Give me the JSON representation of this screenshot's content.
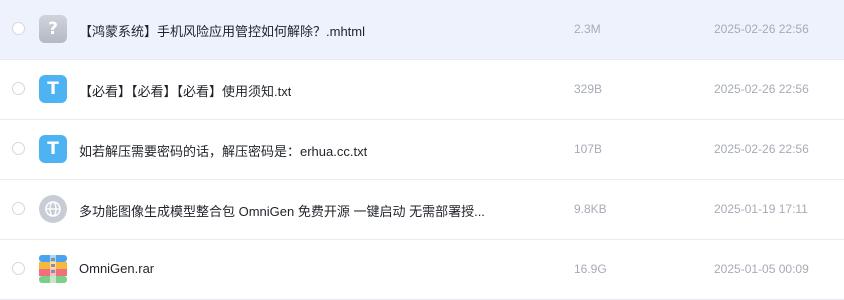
{
  "files": [
    {
      "name": "【鸿蒙系统】手机风险应用管控如何解除？.mhtml",
      "size": "2.3M",
      "date": "2025-02-26 22:56",
      "icon": "unknown-file-icon",
      "icon_glyph": "?"
    },
    {
      "name": "【必看】【必看】【必看】使用须知.txt",
      "size": "329B",
      "date": "2025-02-26 22:56",
      "icon": "text-file-icon",
      "icon_glyph": "T"
    },
    {
      "name": "如若解压需要密码的话，解压密码是：erhua.cc.txt",
      "size": "107B",
      "date": "2025-02-26 22:56",
      "icon": "text-file-icon",
      "icon_glyph": "T"
    },
    {
      "name": "多功能图像生成模型整合包 OmniGen 免费开源 一键启动 无需部署授...",
      "size": "9.8KB",
      "date": "2025-01-19 17:11",
      "icon": "web-link-icon"
    },
    {
      "name": "OmniGen.rar",
      "size": "16.9G",
      "date": "2025-01-05 00:09",
      "icon": "archive-file-icon"
    }
  ],
  "colors": {
    "selected_row": "#eef2fd",
    "text_file_icon": "#4eb3f2"
  }
}
